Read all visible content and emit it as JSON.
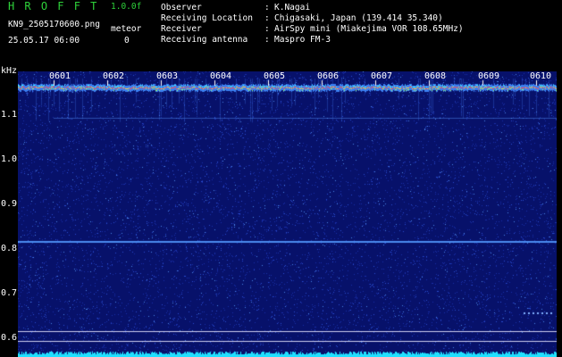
{
  "header": {
    "app_title": "HROFFT",
    "version": "1.0.0f",
    "filename": "KN9_2505170600.png",
    "meteor_label": "meteor",
    "datetime": "25.05.17 06:00",
    "meteor_count": "0",
    "info": [
      {
        "key": "Observer",
        "sep": ":",
        "value": "K.Nagai"
      },
      {
        "key": "Receiving Location",
        "sep": ":",
        "value": "Chigasaki, Japan (139.414 35.340)"
      },
      {
        "key": "Receiver",
        "sep": ":",
        "value": "AirSpy mini (Miakejima VOR 108.65MHz)"
      },
      {
        "key": "Receiving antenna",
        "sep": ":",
        "value": "Maspro FM-3"
      }
    ]
  },
  "spectrogram": {
    "unit_label": "kHz",
    "y_ticks": [
      "1.1",
      "1.0",
      "0.9",
      "0.8",
      "0.7",
      "0.6"
    ],
    "time_ticks": [
      "0601",
      "0602",
      "0603",
      "0604",
      "0605",
      "0606",
      "0607",
      "0608",
      "0609",
      "0610"
    ],
    "background_color": "#07116a",
    "carrier_color": "#ff5050",
    "noise_band_color": "#20e0ff"
  }
}
